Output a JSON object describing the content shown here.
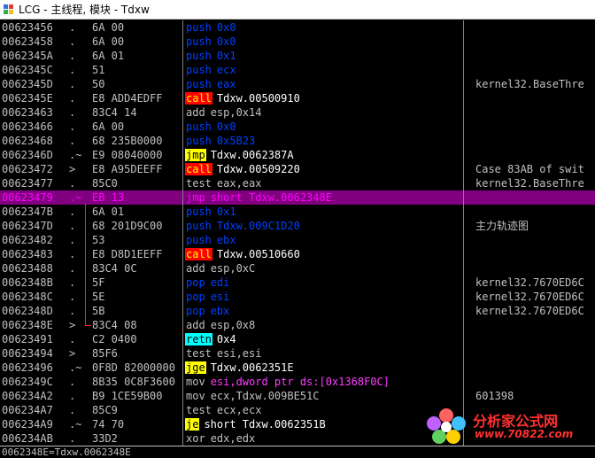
{
  "window": {
    "title": "LCG - 主线程, 模块 - Tdxw"
  },
  "colors": {
    "mnemonic": "#0000ff",
    "call_bg": "#ff0000",
    "call_fg": "#ffff00",
    "jmp_bg": "#ffff00",
    "jmp_fg": "#000000",
    "retn_bg": "#00ffff",
    "retn_fg": "#000000",
    "mov_fg": "#ff3cff",
    "push_fg": "#0040ff",
    "selected_bg": "#800080"
  },
  "rows": [
    {
      "addr": "00623456",
      "mark": ".",
      "hex": "6A 00",
      "mn": "push",
      "op": "0x0",
      "mnstyle": "push",
      "cmt": ""
    },
    {
      "addr": "00623458",
      "mark": ".",
      "hex": "6A 00",
      "mn": "push",
      "op": "0x0",
      "mnstyle": "push",
      "cmt": ""
    },
    {
      "addr": "0062345A",
      "mark": ".",
      "hex": "6A 01",
      "mn": "push",
      "op": "0x1",
      "mnstyle": "push",
      "cmt": ""
    },
    {
      "addr": "0062345C",
      "mark": ".",
      "hex": "51",
      "mn": "push",
      "op": "ecx",
      "mnstyle": "push",
      "cmt": ""
    },
    {
      "addr": "0062345D",
      "mark": ".",
      "hex": "50",
      "mn": "push",
      "op": "eax",
      "mnstyle": "push",
      "cmt": "kernel32.BaseThre"
    },
    {
      "addr": "0062345E",
      "mark": ".",
      "hex": "E8 ADD4EDFF",
      "mn": "call",
      "op": "Tdxw.00500910",
      "mnstyle": "call",
      "cmt": ""
    },
    {
      "addr": "00623463",
      "mark": ".",
      "hex": "83C4 14",
      "mn": "add",
      "op": "esp,0x14",
      "mnstyle": "plain",
      "cmt": ""
    },
    {
      "addr": "00623466",
      "mark": ".",
      "hex": "6A 00",
      "mn": "push",
      "op": "0x0",
      "mnstyle": "push",
      "cmt": ""
    },
    {
      "addr": "00623468",
      "mark": ".",
      "hex": "68 235B0000",
      "mn": "push",
      "op": "0x5B23",
      "mnstyle": "push",
      "cmt": ""
    },
    {
      "addr": "0062346D",
      "mark": ".~",
      "hex": "E9 08040000",
      "mn": "jmp",
      "op": "Tdxw.0062387A",
      "mnstyle": "jmp",
      "cmt": ""
    },
    {
      "addr": "00623472",
      "mark": ">",
      "hex": "E8 A95DEEFF",
      "mn": "call",
      "op": "Tdxw.00509220",
      "mnstyle": "call",
      "cmt": "Case 83AB of swit"
    },
    {
      "addr": "00623477",
      "mark": ".",
      "hex": "85C0",
      "mn": "test",
      "op": "eax,eax",
      "mnstyle": "plain",
      "cmt": "kernel32.BaseThre"
    },
    {
      "addr": "00623479",
      "mark": ".~",
      "hex": "EB 13",
      "mn": "jmp",
      "op": "short Tdxw.0062348E",
      "mnstyle": "sel",
      "cmt": "",
      "selected": true
    },
    {
      "addr": "0062347B",
      "mark": ".",
      "hex": "6A 01",
      "mn": "push",
      "op": "0x1",
      "mnstyle": "push",
      "cmt": ""
    },
    {
      "addr": "0062347D",
      "mark": ".",
      "hex": "68 201D9C00",
      "mn": "push",
      "op": "Tdxw.009C1D20",
      "mnstyle": "push",
      "cmt": "主力轨迹图"
    },
    {
      "addr": "00623482",
      "mark": ".",
      "hex": "53",
      "mn": "push",
      "op": "ebx",
      "mnstyle": "push",
      "cmt": ""
    },
    {
      "addr": "00623483",
      "mark": ".",
      "hex": "E8 D8D1EEFF",
      "mn": "call",
      "op": "Tdxw.00510660",
      "mnstyle": "call",
      "cmt": ""
    },
    {
      "addr": "00623488",
      "mark": ".",
      "hex": "83C4 0C",
      "mn": "add",
      "op": "esp,0xC",
      "mnstyle": "plain",
      "cmt": ""
    },
    {
      "addr": "0062348B",
      "mark": ".",
      "hex": "5F",
      "mn": "pop",
      "op": "edi",
      "mnstyle": "push",
      "cmt": "kernel32.7670ED6C"
    },
    {
      "addr": "0062348C",
      "mark": ".",
      "hex": "5E",
      "mn": "pop",
      "op": "esi",
      "mnstyle": "push",
      "cmt": "kernel32.7670ED6C"
    },
    {
      "addr": "0062348D",
      "mark": ".",
      "hex": "5B",
      "mn": "pop",
      "op": "ebx",
      "mnstyle": "push",
      "cmt": "kernel32.7670ED6C"
    },
    {
      "addr": "0062348E",
      "mark": ">",
      "hex": "83C4 08",
      "mn": "add",
      "op": "esp,0x8",
      "mnstyle": "plain",
      "cmt": ""
    },
    {
      "addr": "00623491",
      "mark": ".",
      "hex": "C2 0400",
      "mn": "retn",
      "op": "0x4",
      "mnstyle": "retn",
      "cmt": ""
    },
    {
      "addr": "00623494",
      "mark": ">",
      "hex": "85F6",
      "mn": "test",
      "op": "esi,esi",
      "mnstyle": "plain",
      "cmt": ""
    },
    {
      "addr": "00623496",
      "mark": ".~",
      "hex": "0F8D 82000000",
      "mn": "jge",
      "op": "Tdxw.0062351E",
      "mnstyle": "jmp",
      "cmt": ""
    },
    {
      "addr": "0062349C",
      "mark": ".",
      "hex": "8B35 0C8F3600",
      "mn": "mov",
      "op": "esi,dword ptr ds:[0x1368F0C]",
      "mnstyle": "mov",
      "cmt": ""
    },
    {
      "addr": "006234A2",
      "mark": ".",
      "hex": "B9 1CE59B00",
      "mn": "mov",
      "op": "ecx,Tdxw.009BE51C",
      "mnstyle": "plain",
      "cmt": "601398"
    },
    {
      "addr": "006234A7",
      "mark": ".",
      "hex": "85C9",
      "mn": "test",
      "op": "ecx,ecx",
      "mnstyle": "plain",
      "cmt": ""
    },
    {
      "addr": "006234A9",
      "mark": ".~",
      "hex": "74 70",
      "mn": "je",
      "op": "short Tdxw.0062351B",
      "mnstyle": "jmp",
      "cmt": ""
    },
    {
      "addr": "006234AB",
      "mark": ".",
      "hex": "33D2",
      "mn": "xor",
      "op": "edx,edx",
      "mnstyle": "plain",
      "cmt": ""
    }
  ],
  "statusbar": {
    "text": "0062348E=Tdxw.0062348E"
  },
  "watermark": {
    "text": "分析家公式网",
    "url": "www.70822.com"
  }
}
